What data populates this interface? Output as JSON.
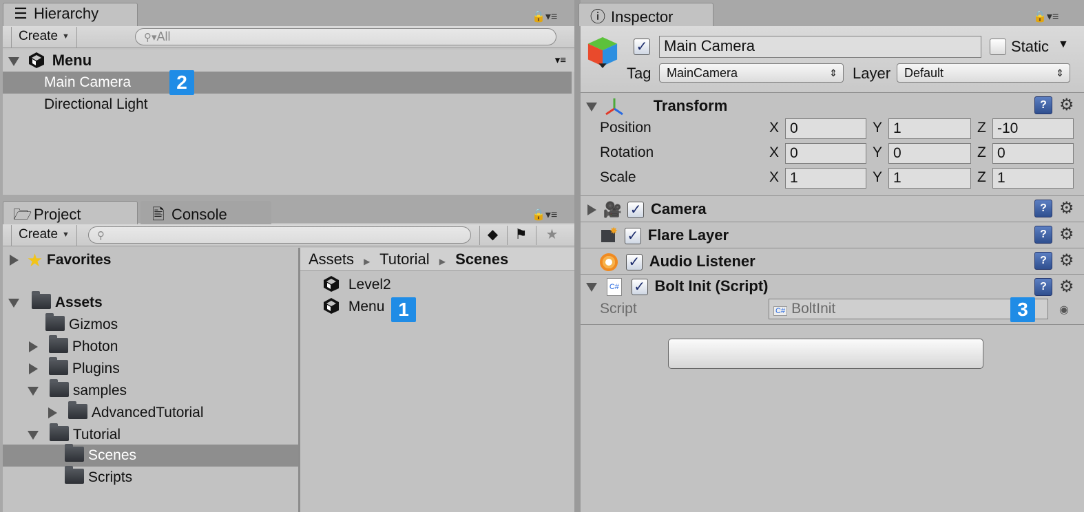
{
  "hierarchy": {
    "tab": "Hierarchy",
    "create": "Create",
    "search_placeholder": "All",
    "scene": "Menu",
    "items": [
      "Main Camera",
      "Directional Light"
    ],
    "badge": "2"
  },
  "project": {
    "tab": "Project",
    "console_tab": "Console",
    "create": "Create",
    "tree": {
      "favorites": "Favorites",
      "assets": "Assets",
      "folders": [
        "Gizmos",
        "Photon",
        "Plugins",
        "samples",
        "AdvancedTutorial",
        "Tutorial",
        "Scenes",
        "Scripts"
      ]
    },
    "breadcrumb": [
      "Assets",
      "Tutorial",
      "Scenes"
    ],
    "files": [
      "Level2",
      "Menu"
    ],
    "badge": "1"
  },
  "inspector": {
    "tab": "Inspector",
    "object_name": "Main Camera",
    "static_label": "Static",
    "tag_label": "Tag",
    "tag_value": "MainCamera",
    "layer_label": "Layer",
    "layer_value": "Default",
    "transform": {
      "title": "Transform",
      "rows": [
        {
          "label": "Position",
          "x": "0",
          "y": "1",
          "z": "-10"
        },
        {
          "label": "Rotation",
          "x": "0",
          "y": "0",
          "z": "0"
        },
        {
          "label": "Scale",
          "x": "1",
          "y": "1",
          "z": "1"
        }
      ],
      "axis_x": "X",
      "axis_y": "Y",
      "axis_z": "Z"
    },
    "components": [
      "Camera",
      "Flare Layer",
      "Audio Listener",
      "Bolt Init (Script)"
    ],
    "script_label": "Script",
    "script_value": "BoltInit",
    "badge": "3"
  },
  "colors": {
    "badge": "#1f8ce6",
    "selection": "#8e8e8e",
    "panel": "#c2c2c2"
  },
  "icons": [
    "hierarchy-list-icon",
    "info-icon",
    "lock-icon",
    "menu-icon",
    "search-icon",
    "folder-icon",
    "unity-scene-icon",
    "star-icon",
    "cube-icon",
    "transform-axes-icon",
    "camera-icon",
    "flare-icon",
    "audio-listener-icon",
    "csharp-script-icon",
    "help-icon",
    "gear-icon"
  ]
}
